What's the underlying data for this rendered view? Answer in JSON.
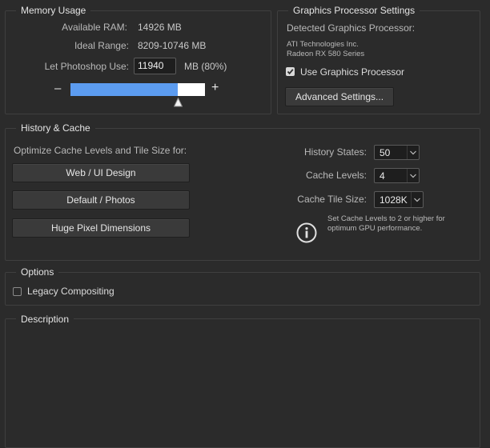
{
  "memory": {
    "title": "Memory Usage",
    "available_label": "Available RAM:",
    "available_value": "14926 MB",
    "ideal_label": "Ideal Range:",
    "ideal_value": "8209-10746 MB",
    "use_label": "Let Photoshop Use:",
    "use_value": "11940",
    "use_unit": "MB (80%)",
    "minus": "–",
    "plus": "+",
    "slider_fraction": 0.8
  },
  "gpu": {
    "title": "Graphics Processor Settings",
    "detected_label": "Detected Graphics Processor:",
    "vendor": "ATI Technologies Inc.",
    "model": "Radeon RX 580 Series",
    "use_gpu_label": "Use Graphics Processor",
    "use_gpu_checked": true,
    "advanced_button": "Advanced Settings..."
  },
  "history": {
    "title": "History & Cache",
    "optimize_label": "Optimize Cache Levels and Tile Size for:",
    "btn_web": "Web / UI Design",
    "btn_default": "Default / Photos",
    "btn_huge": "Huge Pixel Dimensions",
    "states_label": "History States:",
    "states_value": "50",
    "levels_label": "Cache Levels:",
    "levels_value": "4",
    "tile_label": "Cache Tile Size:",
    "tile_value": "1028K",
    "info_line1": "Set Cache Levels to 2 or higher for",
    "info_line2": "optimum GPU performance."
  },
  "options": {
    "title": "Options",
    "legacy_label": "Legacy Compositing",
    "legacy_checked": false
  },
  "description": {
    "title": "Description"
  },
  "colors": {
    "background": "#2b2b2b",
    "slider_fill": "#5c9cf0",
    "slider_track": "#ffffff"
  }
}
